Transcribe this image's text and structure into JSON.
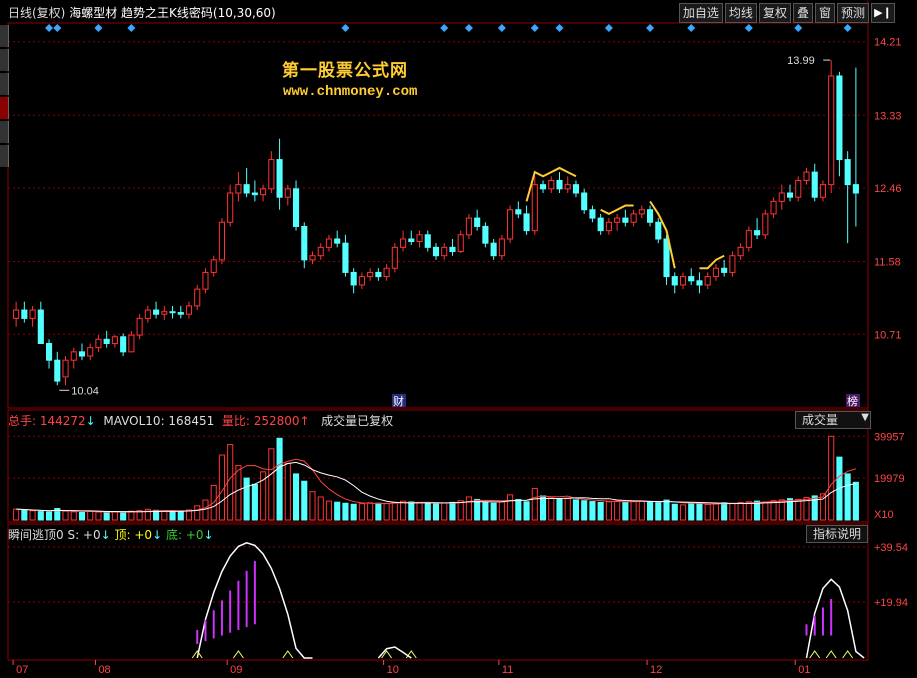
{
  "header": {
    "period": "日线(复权)",
    "stock_name": "海螺型材",
    "indicator": "趋势之王K线密码(10,30,60)"
  },
  "toolbar": {
    "buttons": [
      "加自选",
      "均线",
      "复权",
      "叠",
      "窗",
      "预测"
    ],
    "play_icon": "play-pause-icon"
  },
  "watermark": {
    "line1": "第一股票公式网",
    "line2": "www.chnmoney.com"
  },
  "colors": {
    "up": "#ff3333",
    "down": "#54ffff",
    "grid": "#8b0000",
    "axis_text": "#ff4444",
    "signal_diamond": "#3aa8ff",
    "overlay": "#ffcc33"
  },
  "price_panel": {
    "y_ticks": [
      "14.21",
      "13.33",
      "12.46",
      "11.58",
      "10.71"
    ],
    "high_label": "13.99",
    "low_label": "10.04",
    "marker_cai": "财",
    "marker_bang": "榜"
  },
  "volume_panel": {
    "label_total": "总手: 144272",
    "label_mavol": "MAVOL10: 168451",
    "label_ratio": "量比: 252800",
    "label_status": "成交量已复权",
    "select_value": "成交量",
    "y_ticks": [
      "39957",
      "19979",
      "X10"
    ]
  },
  "indicator_panel": {
    "label_name": "瞬间逃顶0 S: +0",
    "label_top": "顶: +0",
    "label_bottom": "底: +0",
    "button": "指标说明",
    "y_ticks": [
      "+39.54",
      "+19.94"
    ]
  },
  "x_axis": {
    "labels": [
      "07",
      "08",
      "09",
      "10",
      "11",
      "12",
      "01"
    ]
  },
  "chart_data": {
    "type": "candlestick",
    "ylim": [
      9.9,
      14.35
    ],
    "candles": [
      [
        10.9,
        11.1,
        10.8,
        11.0
      ],
      [
        11.0,
        11.1,
        10.85,
        10.9
      ],
      [
        10.9,
        11.05,
        10.8,
        11.0
      ],
      [
        11.0,
        11.1,
        10.6,
        10.6
      ],
      [
        10.6,
        10.65,
        10.3,
        10.4
      ],
      [
        10.4,
        10.5,
        10.1,
        10.15
      ],
      [
        10.2,
        10.45,
        10.1,
        10.4
      ],
      [
        10.4,
        10.55,
        10.3,
        10.5
      ],
      [
        10.5,
        10.6,
        10.4,
        10.45
      ],
      [
        10.45,
        10.6,
        10.4,
        10.55
      ],
      [
        10.55,
        10.7,
        10.5,
        10.65
      ],
      [
        10.65,
        10.75,
        10.55,
        10.6
      ],
      [
        10.6,
        10.7,
        10.55,
        10.68
      ],
      [
        10.68,
        10.72,
        10.45,
        10.5
      ],
      [
        10.5,
        10.75,
        10.5,
        10.7
      ],
      [
        10.7,
        10.95,
        10.65,
        10.9
      ],
      [
        10.9,
        11.05,
        10.85,
        11.0
      ],
      [
        11.0,
        11.1,
        10.9,
        10.95
      ],
      [
        10.95,
        11.05,
        10.88,
        10.98
      ],
      [
        10.98,
        11.05,
        10.9,
        10.97
      ],
      [
        10.97,
        11.05,
        10.9,
        10.95
      ],
      [
        10.95,
        11.1,
        10.9,
        11.05
      ],
      [
        11.05,
        11.3,
        11.0,
        11.25
      ],
      [
        11.25,
        11.5,
        11.2,
        11.45
      ],
      [
        11.45,
        11.65,
        11.4,
        11.6
      ],
      [
        11.6,
        12.1,
        11.55,
        12.05
      ],
      [
        12.05,
        12.5,
        12.0,
        12.4
      ],
      [
        12.4,
        12.65,
        12.3,
        12.5
      ],
      [
        12.5,
        12.7,
        12.35,
        12.4
      ],
      [
        12.4,
        12.55,
        12.3,
        12.38
      ],
      [
        12.38,
        12.5,
        12.3,
        12.45
      ],
      [
        12.45,
        12.9,
        12.4,
        12.8
      ],
      [
        12.8,
        13.05,
        12.2,
        12.35
      ],
      [
        12.35,
        12.5,
        12.25,
        12.45
      ],
      [
        12.45,
        12.55,
        11.95,
        12.0
      ],
      [
        12.0,
        12.05,
        11.5,
        11.6
      ],
      [
        11.6,
        11.7,
        11.55,
        11.65
      ],
      [
        11.65,
        11.8,
        11.6,
        11.75
      ],
      [
        11.75,
        11.9,
        11.7,
        11.85
      ],
      [
        11.85,
        11.95,
        11.75,
        11.8
      ],
      [
        11.8,
        11.9,
        11.4,
        11.45
      ],
      [
        11.45,
        11.5,
        11.2,
        11.3
      ],
      [
        11.3,
        11.45,
        11.25,
        11.4
      ],
      [
        11.4,
        11.5,
        11.35,
        11.45
      ],
      [
        11.45,
        11.5,
        11.35,
        11.4
      ],
      [
        11.4,
        11.55,
        11.35,
        11.5
      ],
      [
        11.5,
        11.8,
        11.45,
        11.75
      ],
      [
        11.75,
        11.95,
        11.7,
        11.85
      ],
      [
        11.85,
        11.95,
        11.78,
        11.82
      ],
      [
        11.82,
        11.95,
        11.75,
        11.9
      ],
      [
        11.9,
        11.95,
        11.7,
        11.75
      ],
      [
        11.75,
        11.8,
        11.6,
        11.65
      ],
      [
        11.65,
        11.8,
        11.6,
        11.75
      ],
      [
        11.75,
        11.85,
        11.65,
        11.7
      ],
      [
        11.7,
        11.95,
        11.68,
        11.9
      ],
      [
        11.9,
        12.15,
        11.85,
        12.1
      ],
      [
        12.1,
        12.2,
        11.95,
        12.0
      ],
      [
        12.0,
        12.05,
        11.75,
        11.8
      ],
      [
        11.8,
        11.85,
        11.6,
        11.65
      ],
      [
        11.65,
        11.9,
        11.6,
        11.85
      ],
      [
        11.85,
        12.25,
        11.8,
        12.2
      ],
      [
        12.2,
        12.3,
        12.1,
        12.15
      ],
      [
        12.15,
        12.25,
        11.9,
        11.95
      ],
      [
        11.95,
        12.6,
        11.9,
        12.5
      ],
      [
        12.5,
        12.55,
        12.4,
        12.45
      ],
      [
        12.45,
        12.6,
        12.4,
        12.55
      ],
      [
        12.55,
        12.65,
        12.4,
        12.45
      ],
      [
        12.45,
        12.6,
        12.4,
        12.5
      ],
      [
        12.5,
        12.55,
        12.35,
        12.4
      ],
      [
        12.4,
        12.45,
        12.15,
        12.2
      ],
      [
        12.2,
        12.25,
        12.05,
        12.1
      ],
      [
        12.1,
        12.15,
        11.9,
        11.95
      ],
      [
        11.95,
        12.1,
        11.9,
        12.05
      ],
      [
        12.05,
        12.15,
        11.95,
        12.1
      ],
      [
        12.1,
        12.2,
        12.0,
        12.05
      ],
      [
        12.05,
        12.2,
        12.0,
        12.15
      ],
      [
        12.15,
        12.25,
        12.1,
        12.2
      ],
      [
        12.2,
        12.25,
        12.0,
        12.05
      ],
      [
        12.05,
        12.1,
        11.8,
        11.85
      ],
      [
        11.85,
        11.9,
        11.3,
        11.4
      ],
      [
        11.4,
        11.45,
        11.2,
        11.3
      ],
      [
        11.3,
        11.45,
        11.25,
        11.4
      ],
      [
        11.4,
        11.5,
        11.3,
        11.35
      ],
      [
        11.35,
        11.45,
        11.2,
        11.3
      ],
      [
        11.3,
        11.45,
        11.25,
        11.4
      ],
      [
        11.4,
        11.55,
        11.35,
        11.5
      ],
      [
        11.5,
        11.6,
        11.4,
        11.45
      ],
      [
        11.45,
        11.7,
        11.4,
        11.65
      ],
      [
        11.65,
        11.8,
        11.6,
        11.75
      ],
      [
        11.75,
        12.0,
        11.7,
        11.95
      ],
      [
        11.95,
        12.1,
        11.85,
        11.9
      ],
      [
        11.9,
        12.2,
        11.85,
        12.15
      ],
      [
        12.15,
        12.35,
        12.1,
        12.3
      ],
      [
        12.3,
        12.5,
        12.2,
        12.4
      ],
      [
        12.4,
        12.5,
        12.3,
        12.35
      ],
      [
        12.35,
        12.6,
        12.3,
        12.55
      ],
      [
        12.55,
        12.7,
        12.5,
        12.65
      ],
      [
        12.65,
        12.75,
        12.3,
        12.35
      ],
      [
        12.35,
        12.55,
        12.3,
        12.5
      ],
      [
        12.5,
        13.99,
        12.4,
        13.8
      ],
      [
        13.8,
        13.85,
        12.6,
        12.8
      ],
      [
        12.8,
        12.9,
        11.8,
        12.5
      ],
      [
        12.5,
        13.9,
        12.0,
        12.4
      ]
    ],
    "volume": {
      "ylim": [
        0,
        42000
      ],
      "values": [
        5200,
        4800,
        4400,
        4000,
        3800,
        5500,
        4200,
        3900,
        3600,
        4100,
        3800,
        3500,
        3900,
        3400,
        4200,
        4500,
        5100,
        4600,
        4300,
        4100,
        4000,
        4800,
        6800,
        9500,
        16500,
        31000,
        36000,
        26000,
        20000,
        17000,
        23000,
        34000,
        39000,
        27000,
        22000,
        18500,
        13500,
        11000,
        9000,
        8500,
        8000,
        7500,
        7800,
        8200,
        8000,
        7800,
        8500,
        9000,
        8600,
        8300,
        7900,
        7600,
        8100,
        8400,
        9200,
        11000,
        9800,
        8500,
        8000,
        8600,
        12000,
        9800,
        8700,
        15000,
        11500,
        10500,
        9800,
        10200,
        9600,
        9200,
        8800,
        8400,
        8700,
        9000,
        8600,
        8900,
        9100,
        8700,
        8300,
        9500,
        7500,
        7200,
        7800,
        8000,
        7400,
        7600,
        8200,
        7900,
        8400,
        8700,
        9000,
        8600,
        9200,
        9600,
        10200,
        9800,
        10800,
        11500,
        12500,
        39957,
        30000,
        22000,
        18000
      ]
    },
    "indicator": {
      "ylim": [
        0,
        42
      ]
    }
  }
}
